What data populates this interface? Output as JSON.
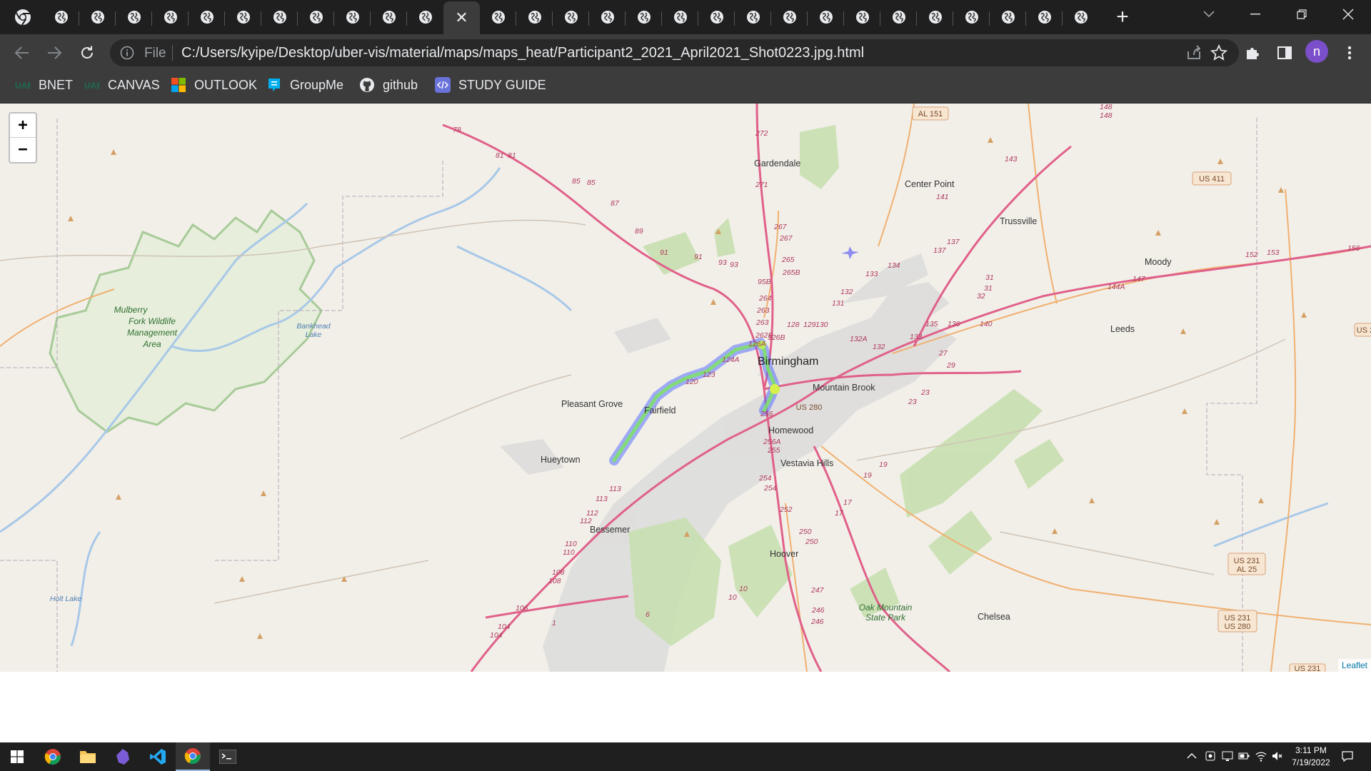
{
  "browser": {
    "tab_count": 29,
    "active_tab_index": 11,
    "address": {
      "scheme_label": "File",
      "url": "C:/Users/kyipe/Desktop/uber-vis/material/maps/maps_heat/Participant2_2021_April2021_Shot0223.jpg.html"
    },
    "profile_initial": "n",
    "bookmarks": [
      {
        "label": "BNET",
        "icon": "uab-icon"
      },
      {
        "label": "CANVAS",
        "icon": "uab-icon"
      },
      {
        "label": "OUTLOOK",
        "icon": "microsoft-icon"
      },
      {
        "label": "GroupMe",
        "icon": "groupme-icon"
      },
      {
        "label": "github",
        "icon": "github-icon"
      },
      {
        "label": "STUDY GUIDE",
        "icon": "code-icon"
      }
    ]
  },
  "map": {
    "zoom_in": "+",
    "zoom_out": "−",
    "attribution": "Leaflet",
    "places": {
      "birmingham": "Birmingham",
      "gardendale": "Gardendale",
      "center_point": "Center Point",
      "trussville": "Trussville",
      "moody": "Moody",
      "leeds": "Leeds",
      "pleasant_grove": "Pleasant Grove",
      "fairfield": "Fairfield",
      "hueytown": "Hueytown",
      "bessemer": "Bessemer",
      "homewood": "Homewood",
      "mountain_brook": "Mountain Brook",
      "vestavia_hills": "Vestavia Hills",
      "hoover": "Hoover",
      "chelsea": "Chelsea"
    },
    "parks": {
      "mulberry_l1": "Mulberry",
      "mulberry_l2": "Fork Wildlife",
      "mulberry_l3": "Management",
      "mulberry_l4": "Area",
      "oak_l1": "Oak Mountain",
      "oak_l2": "State Park"
    },
    "water": {
      "bankhead_l1": "Bankhead",
      "bankhead_l2": "Lake",
      "holt": "Holt Lake"
    },
    "shields": {
      "al151": "AL 151",
      "us411": "US 411",
      "us280": "US 280",
      "us231_al25_l1": "US 231",
      "us231_al25_l2": "AL 25",
      "us231_us280_l1": "US 231",
      "us231_us280_l2": "US 280",
      "us_edge": "US 2",
      "us_bottom": "US 231"
    },
    "route_numbers": [
      "272",
      "271",
      "267",
      "267",
      "265",
      "265B",
      "95B",
      "264",
      "263",
      "263",
      "262B",
      "126B",
      "128",
      "129",
      "130",
      "131",
      "132",
      "132A",
      "132",
      "133",
      "134",
      "133",
      "135",
      "136",
      "137",
      "137",
      "141",
      "143",
      "140",
      "144A",
      "147",
      "152",
      "153",
      "156",
      "148",
      "148",
      "78",
      "81",
      "81",
      "85",
      "85",
      "87",
      "89",
      "91",
      "91",
      "93",
      "93",
      "120",
      "123",
      "124A",
      "126A",
      "256",
      "256A",
      "255",
      "254",
      "254",
      "252",
      "250",
      "250",
      "247",
      "246",
      "246",
      "113",
      "113",
      "112",
      "112",
      "110",
      "110",
      "108",
      "108",
      "106",
      "104",
      "104",
      "27",
      "29",
      "31",
      "31",
      "32",
      "23",
      "23",
      "19",
      "19",
      "17",
      "17",
      "10",
      "10",
      "6",
      "1"
    ]
  },
  "taskbar": {
    "time": "3:11 PM",
    "date": "7/19/2022",
    "apps": [
      "start-icon",
      "chrome-icon",
      "file-explorer-icon",
      "obsidian-icon",
      "vscode-icon",
      "chrome-icon",
      "terminal-icon"
    ]
  }
}
